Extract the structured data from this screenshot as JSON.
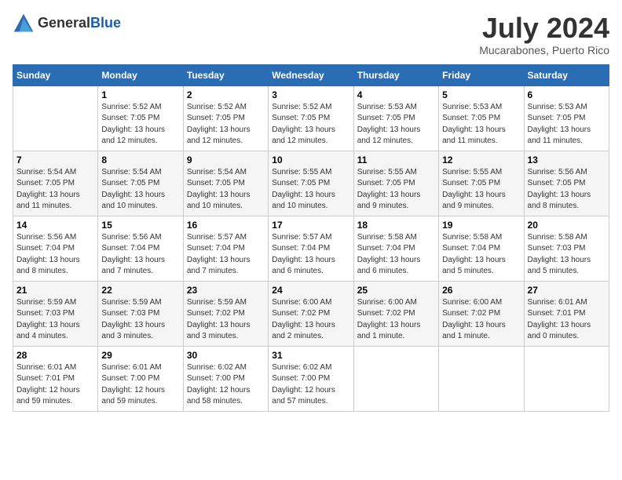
{
  "header": {
    "logo_general": "General",
    "logo_blue": "Blue",
    "month_year": "July 2024",
    "location": "Mucarabones, Puerto Rico"
  },
  "weekdays": [
    "Sunday",
    "Monday",
    "Tuesday",
    "Wednesday",
    "Thursday",
    "Friday",
    "Saturday"
  ],
  "weeks": [
    [
      {
        "day": "",
        "info": ""
      },
      {
        "day": "1",
        "info": "Sunrise: 5:52 AM\nSunset: 7:05 PM\nDaylight: 13 hours\nand 12 minutes."
      },
      {
        "day": "2",
        "info": "Sunrise: 5:52 AM\nSunset: 7:05 PM\nDaylight: 13 hours\nand 12 minutes."
      },
      {
        "day": "3",
        "info": "Sunrise: 5:52 AM\nSunset: 7:05 PM\nDaylight: 13 hours\nand 12 minutes."
      },
      {
        "day": "4",
        "info": "Sunrise: 5:53 AM\nSunset: 7:05 PM\nDaylight: 13 hours\nand 12 minutes."
      },
      {
        "day": "5",
        "info": "Sunrise: 5:53 AM\nSunset: 7:05 PM\nDaylight: 13 hours\nand 11 minutes."
      },
      {
        "day": "6",
        "info": "Sunrise: 5:53 AM\nSunset: 7:05 PM\nDaylight: 13 hours\nand 11 minutes."
      }
    ],
    [
      {
        "day": "7",
        "info": "Sunrise: 5:54 AM\nSunset: 7:05 PM\nDaylight: 13 hours\nand 11 minutes."
      },
      {
        "day": "8",
        "info": "Sunrise: 5:54 AM\nSunset: 7:05 PM\nDaylight: 13 hours\nand 10 minutes."
      },
      {
        "day": "9",
        "info": "Sunrise: 5:54 AM\nSunset: 7:05 PM\nDaylight: 13 hours\nand 10 minutes."
      },
      {
        "day": "10",
        "info": "Sunrise: 5:55 AM\nSunset: 7:05 PM\nDaylight: 13 hours\nand 10 minutes."
      },
      {
        "day": "11",
        "info": "Sunrise: 5:55 AM\nSunset: 7:05 PM\nDaylight: 13 hours\nand 9 minutes."
      },
      {
        "day": "12",
        "info": "Sunrise: 5:55 AM\nSunset: 7:05 PM\nDaylight: 13 hours\nand 9 minutes."
      },
      {
        "day": "13",
        "info": "Sunrise: 5:56 AM\nSunset: 7:05 PM\nDaylight: 13 hours\nand 8 minutes."
      }
    ],
    [
      {
        "day": "14",
        "info": "Sunrise: 5:56 AM\nSunset: 7:04 PM\nDaylight: 13 hours\nand 8 minutes."
      },
      {
        "day": "15",
        "info": "Sunrise: 5:56 AM\nSunset: 7:04 PM\nDaylight: 13 hours\nand 7 minutes."
      },
      {
        "day": "16",
        "info": "Sunrise: 5:57 AM\nSunset: 7:04 PM\nDaylight: 13 hours\nand 7 minutes."
      },
      {
        "day": "17",
        "info": "Sunrise: 5:57 AM\nSunset: 7:04 PM\nDaylight: 13 hours\nand 6 minutes."
      },
      {
        "day": "18",
        "info": "Sunrise: 5:58 AM\nSunset: 7:04 PM\nDaylight: 13 hours\nand 6 minutes."
      },
      {
        "day": "19",
        "info": "Sunrise: 5:58 AM\nSunset: 7:04 PM\nDaylight: 13 hours\nand 5 minutes."
      },
      {
        "day": "20",
        "info": "Sunrise: 5:58 AM\nSunset: 7:03 PM\nDaylight: 13 hours\nand 5 minutes."
      }
    ],
    [
      {
        "day": "21",
        "info": "Sunrise: 5:59 AM\nSunset: 7:03 PM\nDaylight: 13 hours\nand 4 minutes."
      },
      {
        "day": "22",
        "info": "Sunrise: 5:59 AM\nSunset: 7:03 PM\nDaylight: 13 hours\nand 3 minutes."
      },
      {
        "day": "23",
        "info": "Sunrise: 5:59 AM\nSunset: 7:02 PM\nDaylight: 13 hours\nand 3 minutes."
      },
      {
        "day": "24",
        "info": "Sunrise: 6:00 AM\nSunset: 7:02 PM\nDaylight: 13 hours\nand 2 minutes."
      },
      {
        "day": "25",
        "info": "Sunrise: 6:00 AM\nSunset: 7:02 PM\nDaylight: 13 hours\nand 1 minute."
      },
      {
        "day": "26",
        "info": "Sunrise: 6:00 AM\nSunset: 7:02 PM\nDaylight: 13 hours\nand 1 minute."
      },
      {
        "day": "27",
        "info": "Sunrise: 6:01 AM\nSunset: 7:01 PM\nDaylight: 13 hours\nand 0 minutes."
      }
    ],
    [
      {
        "day": "28",
        "info": "Sunrise: 6:01 AM\nSunset: 7:01 PM\nDaylight: 12 hours\nand 59 minutes."
      },
      {
        "day": "29",
        "info": "Sunrise: 6:01 AM\nSunset: 7:00 PM\nDaylight: 12 hours\nand 59 minutes."
      },
      {
        "day": "30",
        "info": "Sunrise: 6:02 AM\nSunset: 7:00 PM\nDaylight: 12 hours\nand 58 minutes."
      },
      {
        "day": "31",
        "info": "Sunrise: 6:02 AM\nSunset: 7:00 PM\nDaylight: 12 hours\nand 57 minutes."
      },
      {
        "day": "",
        "info": ""
      },
      {
        "day": "",
        "info": ""
      },
      {
        "day": "",
        "info": ""
      }
    ]
  ]
}
